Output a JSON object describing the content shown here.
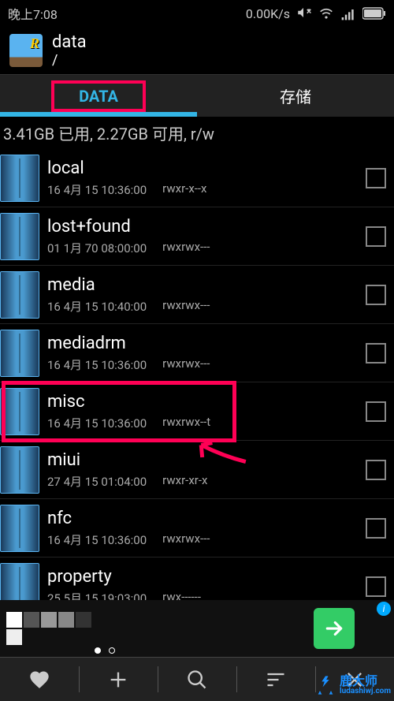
{
  "status": {
    "time": "晚上7:08",
    "speed": "0.00K/s"
  },
  "header": {
    "title": "data",
    "path": "/"
  },
  "tabs": [
    {
      "label": "DATA",
      "active": true
    },
    {
      "label": "存储",
      "active": false
    }
  ],
  "storage_info": "3.41GB 已用, 2.27GB 可用, r/w",
  "files": [
    {
      "name": "local",
      "date": "16 4月 15 10:36:00",
      "perm": "rwxr-x--x",
      "highlighted": false
    },
    {
      "name": "lost+found",
      "date": "01 1月 70 08:00:00",
      "perm": "rwxrwx---",
      "highlighted": false
    },
    {
      "name": "media",
      "date": "16 4月 15 10:40:00",
      "perm": "rwxrwx---",
      "highlighted": false
    },
    {
      "name": "mediadrm",
      "date": "16 4月 15 10:36:00",
      "perm": "rwxrwx---",
      "highlighted": false
    },
    {
      "name": "misc",
      "date": "16 4月 15 10:36:00",
      "perm": "rwxrwx--t",
      "highlighted": true
    },
    {
      "name": "miui",
      "date": "27 4月 15 01:04:00",
      "perm": "rwxr-xr-x",
      "highlighted": false
    },
    {
      "name": "nfc",
      "date": "16 4月 15 10:36:00",
      "perm": "rwxrwx---",
      "highlighted": false
    },
    {
      "name": "property",
      "date": "25 5月 15 19:03:00",
      "perm": "rwx------",
      "highlighted": false
    }
  ],
  "ad": {
    "info_label": "i"
  },
  "watermark": {
    "name": "鹿大师",
    "url": "ludashiwj.com"
  }
}
